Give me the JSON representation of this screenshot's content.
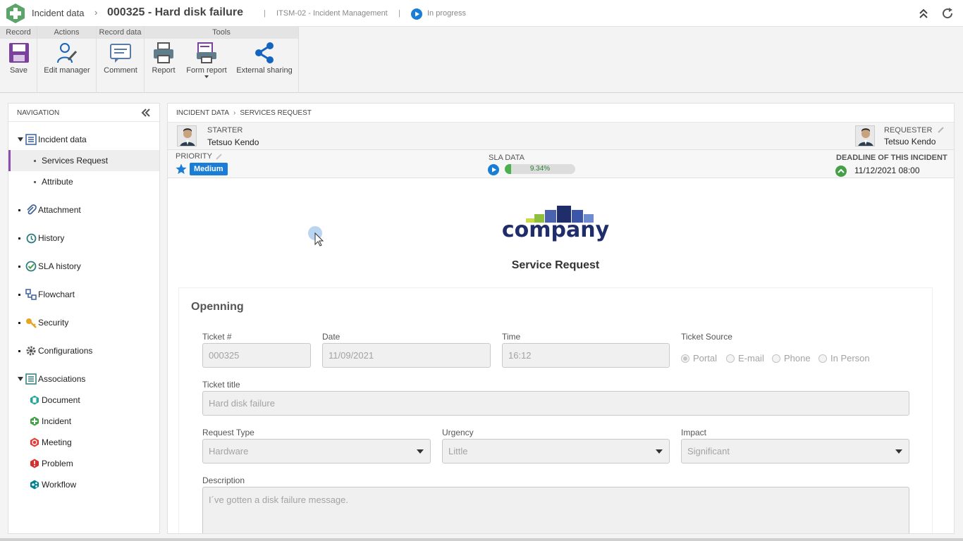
{
  "titlebar": {
    "module": "Incident data",
    "separator": "›",
    "record": "000325 - Hard disk failure",
    "pipe": "|",
    "process": "ITSM-02 - Incident Management",
    "status": "In progress",
    "icons": [
      "app-logo",
      "play-status-icon",
      "collapse-up-icon",
      "refresh-icon"
    ]
  },
  "ribbon": {
    "groups": [
      "Record",
      "Actions",
      "Record data",
      "Tools"
    ],
    "buttons": {
      "save": "Save",
      "edit_manager": "Edit manager",
      "comment": "Comment",
      "report": "Report",
      "form_report": "Form report",
      "external_sharing": "External sharing"
    }
  },
  "nav": {
    "title": "NAVIGATION",
    "incident_data": "Incident data",
    "services_request": "Services Request",
    "attribute": "Attribute",
    "attachment": "Attachment",
    "history": "History",
    "sla_history": "SLA history",
    "flowchart": "Flowchart",
    "security": "Security",
    "configurations": "Configurations",
    "associations": "Associations",
    "document": "Document",
    "incident": "Incident",
    "meeting": "Meeting",
    "problem": "Problem",
    "workflow": "Workflow"
  },
  "breadcrumb": {
    "level1": "INCIDENT DATA",
    "level2": "SERVICES REQUEST"
  },
  "info": {
    "starter_label": "STARTER",
    "starter_name": "Tetsuo Kendo",
    "requester_label": "REQUESTER",
    "requester_name": "Tetsuo Kendo",
    "priority_label": "PRIORITY",
    "priority_value": "Medium",
    "sla_label": "SLA DATA",
    "sla_percent_text": "9.34%",
    "sla_progress": 0.0934,
    "deadline_label": "DEADLINE OF THIS INCIDENT",
    "deadline_value": "11/12/2021 08:00"
  },
  "form": {
    "logo_text": "company",
    "title": "Service Request",
    "section": "Openning",
    "ticket_label": "Ticket #",
    "ticket_value": "000325",
    "date_label": "Date",
    "date_value": "11/09/2021",
    "time_label": "Time",
    "time_value": "16:12",
    "source_label": "Ticket Source",
    "source_options": [
      "Portal",
      "E-mail",
      "Phone",
      "In Person"
    ],
    "source_selected": "Portal",
    "title_label": "Ticket title",
    "title_value": "Hard disk failure",
    "request_type_label": "Request Type",
    "request_type_value": "Hardware",
    "urgency_label": "Urgency",
    "urgency_value": "Little",
    "impact_label": "Impact",
    "impact_value": "Significant",
    "description_label": "Description",
    "description_value": "I´ve gotten a disk failure message."
  },
  "colors": {
    "accent_purple": "#8a4fb0",
    "priority_blue": "#1b7ed6",
    "sla_green": "#4caf50",
    "logo_navy": "#1f2d6b"
  }
}
